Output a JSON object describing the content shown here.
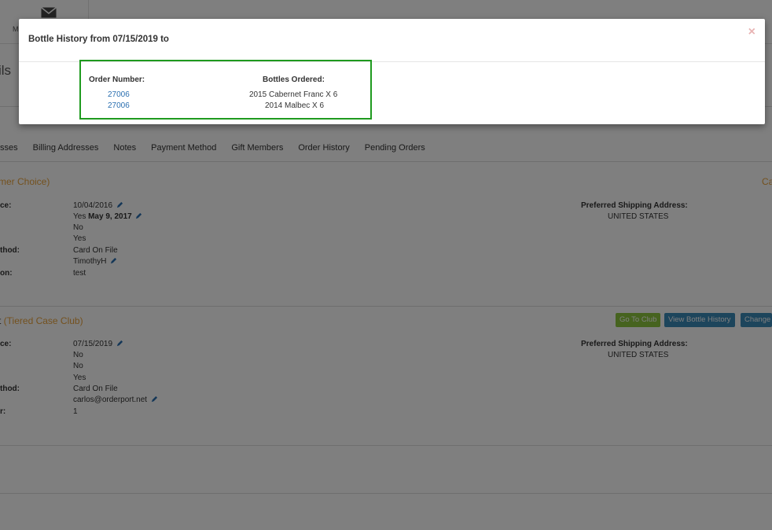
{
  "topbar": {
    "mail_label": "M"
  },
  "page": {
    "title": "ils"
  },
  "tabs": [
    "sses",
    "Billing Addresses",
    "Notes",
    "Payment Method",
    "Gift Members",
    "Order History",
    "Pending Orders"
  ],
  "section1": {
    "title": "mer Choice)",
    "right_tag": "Ca",
    "labels": [
      "ce:",
      "thod:",
      "on:"
    ],
    "values": {
      "date": "10/04/2016",
      "yes_prefix": "Yes ",
      "yes_date": "May 9, 2017",
      "v3": "No",
      "v4": "Yes",
      "v5": "Card On File",
      "v6": "TimothyH",
      "v7": "test"
    },
    "ship_label": "Preferred Shipping Address:",
    "ship_value": "UNITED STATES"
  },
  "section2": {
    "title_prefix": "t ",
    "title": "(Tiered Case Club)",
    "labels": [
      "ce:",
      "thod:",
      "r:"
    ],
    "values": {
      "date": "07/15/2019",
      "v2": "No",
      "v3": "No",
      "v4": "Yes",
      "v5": "Card On File",
      "v6": "carlos@orderport.net",
      "v7": "1"
    },
    "ship_label": "Preferred Shipping Address:",
    "ship_value": "UNITED STATES",
    "buttons": {
      "go_to_club": "Go To Club",
      "view_history": "View Bottle History",
      "change": "Change"
    }
  },
  "modal": {
    "title": "Bottle History from 07/15/2019 to",
    "close_glyph": "×",
    "headers": {
      "order_number": "Order Number:",
      "bottles_ordered": "Bottles Ordered:"
    },
    "rows": [
      {
        "order": "27006",
        "bottles": "2015 Cabernet Franc X 6"
      },
      {
        "order": "27006",
        "bottles": "2014 Malbec X 6"
      }
    ]
  },
  "colors": {
    "accent_orange": "#e8a33d",
    "link_blue": "#2a6fb0",
    "btn_green": "#8cc63f",
    "btn_blue": "#3a8ab8",
    "highlight_green": "#1f9a1f"
  }
}
